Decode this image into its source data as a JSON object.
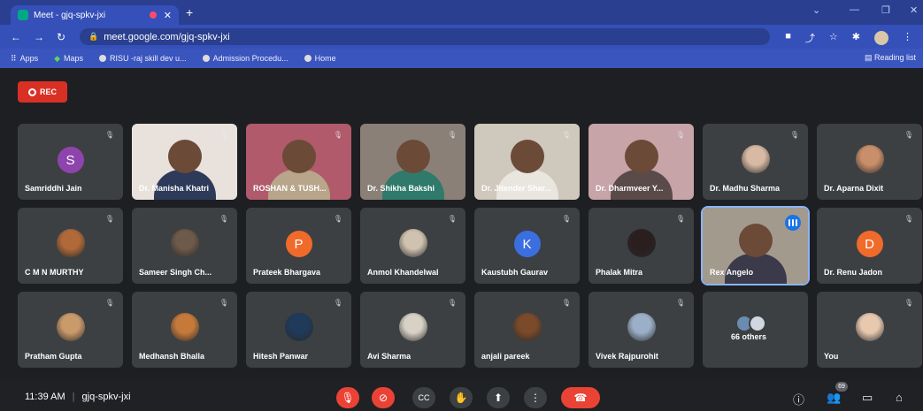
{
  "browser": {
    "tab_title": "Meet - gjq-spkv-jxi",
    "tab_close": "✕",
    "new_tab": "+",
    "url": "meet.google.com/gjq-spkv-jxi",
    "bookmarks": [
      "Apps",
      "Maps",
      "RISU -raj skill dev u...",
      "Admission Procedu...",
      "Home"
    ],
    "reading_list": "Reading list"
  },
  "recording": {
    "label": "REC"
  },
  "tiles": [
    {
      "name": "Samriddhi Jain",
      "kind": "letter",
      "letter": "S",
      "color": "#8e44ad"
    },
    {
      "name": "Dr. Manisha Khatri",
      "kind": "video",
      "bg": "#e9e2dc",
      "body": "#2d3a5a"
    },
    {
      "name": "ROSHAN & TUSH...",
      "kind": "video",
      "bg": "#b05a6c",
      "body": "#b8a58a"
    },
    {
      "name": "Dr. Shikha Bakshi",
      "kind": "video",
      "bg": "#8a8078",
      "body": "#2f7a6a"
    },
    {
      "name": "Dr. Jitender Shar...",
      "kind": "video",
      "bg": "#cfc8bc",
      "body": "#e9e6df"
    },
    {
      "name": "Dr. Dharmveer Y...",
      "kind": "video",
      "bg": "#c6a4a8",
      "body": "#5a4a4a"
    },
    {
      "name": "Dr. Madhu Sharma",
      "kind": "photo",
      "color": "#d8b9a4"
    },
    {
      "name": "Dr. Aparna Dixit",
      "kind": "photo",
      "color": "#c98f6a"
    },
    {
      "name": "C M N MURTHY",
      "kind": "photo",
      "color": "#b06a3a"
    },
    {
      "name": "Sameer Singh Ch...",
      "kind": "photo",
      "color": "#6e5a4a"
    },
    {
      "name": "Prateek Bhargava",
      "kind": "letter",
      "letter": "P",
      "color": "#f06a2a"
    },
    {
      "name": "Anmol Khandelwal",
      "kind": "photo",
      "color": "#cfc3b0"
    },
    {
      "name": "Kaustubh Gaurav",
      "kind": "letter",
      "letter": "K",
      "color": "#3b6fe0"
    },
    {
      "name": "Phalak Mitra",
      "kind": "photo",
      "color": "#2a1e1e"
    },
    {
      "name": "Rex Angelo",
      "kind": "video",
      "bg": "#a39a8e",
      "body": "#3a3a4a",
      "active": true
    },
    {
      "name": "Dr. Renu Jadon",
      "kind": "letter",
      "letter": "D",
      "color": "#f06a2a"
    },
    {
      "name": "Pratham Gupta",
      "kind": "photo",
      "color": "#c99a6a"
    },
    {
      "name": "Medhansh Bhalla",
      "kind": "photo",
      "color": "#c57a3a"
    },
    {
      "name": "Hitesh Panwar",
      "kind": "photo",
      "color": "#1f3a5a"
    },
    {
      "name": "Avi Sharma",
      "kind": "photo",
      "color": "#d7d1c6"
    },
    {
      "name": "anjali pareek",
      "kind": "photo",
      "color": "#7a4a2a"
    },
    {
      "name": "Vivek Rajpurohit",
      "kind": "photo",
      "color": "#9bb0c8"
    },
    {
      "name": "66 others",
      "kind": "others"
    },
    {
      "name": "You",
      "kind": "photo",
      "color": "#e8c9b0"
    }
  ],
  "footer": {
    "time": "11:39 AM",
    "separator": "|",
    "meeting_code": "gjq-spkv-jxi",
    "participants_count": "69"
  },
  "colors": {
    "accent": "#1a73e8",
    "danger": "#ea4335",
    "tile": "#3c4043"
  }
}
